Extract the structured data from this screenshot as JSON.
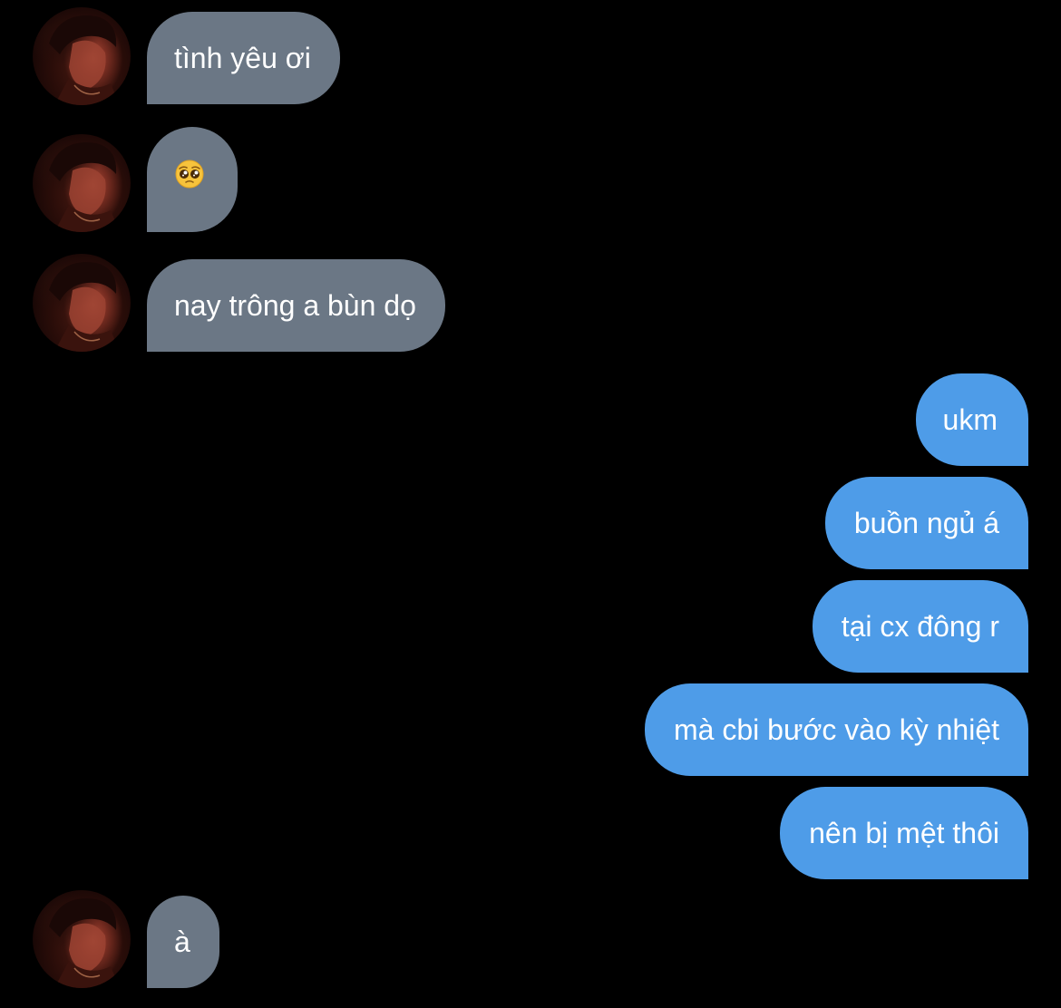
{
  "contact": {
    "avatar_icon": "profile-photo-avatar"
  },
  "messages": [
    {
      "sender": "them",
      "text": "tình yêu ơi"
    },
    {
      "sender": "them",
      "text": "",
      "emoji": "pleading-face-emoji"
    },
    {
      "sender": "them",
      "text": "nay trông a bùn dọ"
    },
    {
      "sender": "me",
      "text": "ukm"
    },
    {
      "sender": "me",
      "text": "buồn ngủ á"
    },
    {
      "sender": "me",
      "text": "tại cx đông r"
    },
    {
      "sender": "me",
      "text": "mà cbi bước vào kỳ nhiệt"
    },
    {
      "sender": "me",
      "text": "nên bị mệt thôi"
    },
    {
      "sender": "them",
      "text": "à"
    }
  ],
  "colors": {
    "background": "#000000",
    "incoming_bubble": "#6b7785",
    "outgoing_bubble": "#4e9ce8",
    "text": "#ffffff"
  }
}
